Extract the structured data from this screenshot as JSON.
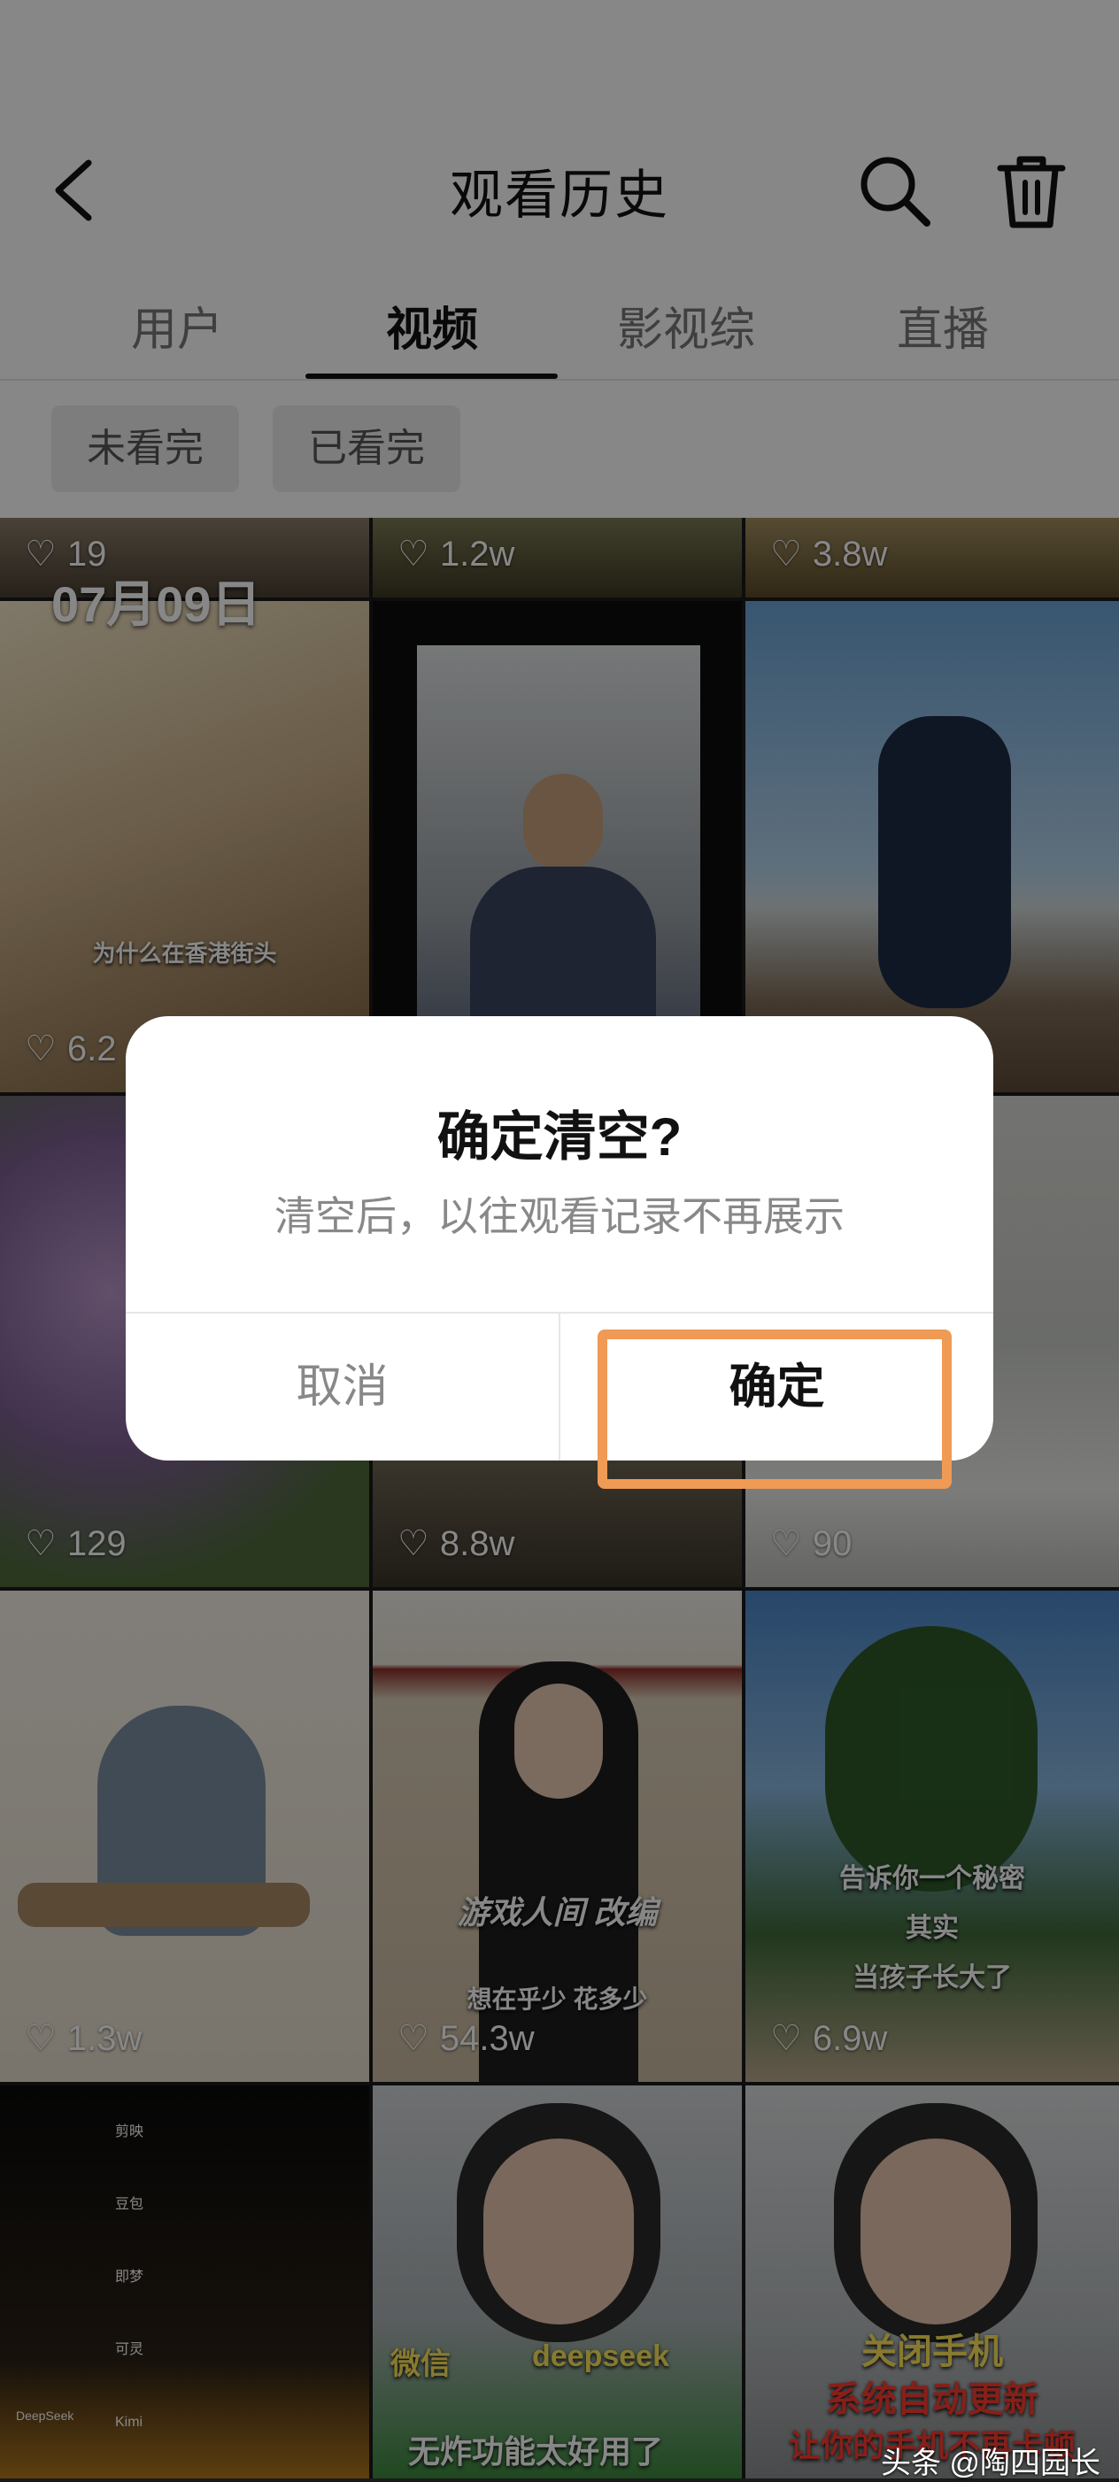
{
  "header": {
    "title": "观看历史",
    "back_icon": "chevron-left-icon",
    "search_icon": "search-icon",
    "delete_icon": "trash-icon"
  },
  "tabs": [
    {
      "label": "用户",
      "active": false
    },
    {
      "label": "视频",
      "active": true
    },
    {
      "label": "影视综",
      "active": false
    },
    {
      "label": "直播",
      "active": false
    }
  ],
  "filters": [
    "未看完",
    "已看完"
  ],
  "section_date": "07月09日",
  "videos": [
    {
      "likes": "19"
    },
    {
      "likes": "1.2w"
    },
    {
      "likes": "3.8w"
    },
    {
      "likes": "6.2",
      "caption": "为什么在香港街头"
    },
    {
      "likes": ""
    },
    {
      "likes": ""
    },
    {
      "likes": "129"
    },
    {
      "likes": "8.8w"
    },
    {
      "likes": "90"
    },
    {
      "likes": "1.3w"
    },
    {
      "likes": "54.3w",
      "caption": "游戏人间 改编",
      "caption2": "想在乎少 花多少"
    },
    {
      "likes": "6.9w",
      "caption": "告诉你一个秘密",
      "caption2": "其实",
      "caption3": "当孩子长大了"
    },
    {
      "likes": "",
      "labels": [
        "剪映",
        "豆包",
        "即梦",
        "可灵",
        "Kimi",
        "DeepSeek"
      ]
    },
    {
      "likes": "",
      "caption": "微信",
      "caption2": "deepseek",
      "caption3": "无炸功能太好用了"
    },
    {
      "likes": "",
      "caption": "关闭手机",
      "caption2": "系统自动更新",
      "caption3": "让你的手机不再卡顿"
    }
  ],
  "dialog": {
    "title": "确定清空?",
    "message": "清空后，以往观看记录不再展示",
    "cancel": "取消",
    "confirm": "确定"
  },
  "watermark": "头条 @陶四园长",
  "colors": {
    "highlight": "#ef9a55",
    "overlay": "rgba(0,0,0,0.47)"
  }
}
